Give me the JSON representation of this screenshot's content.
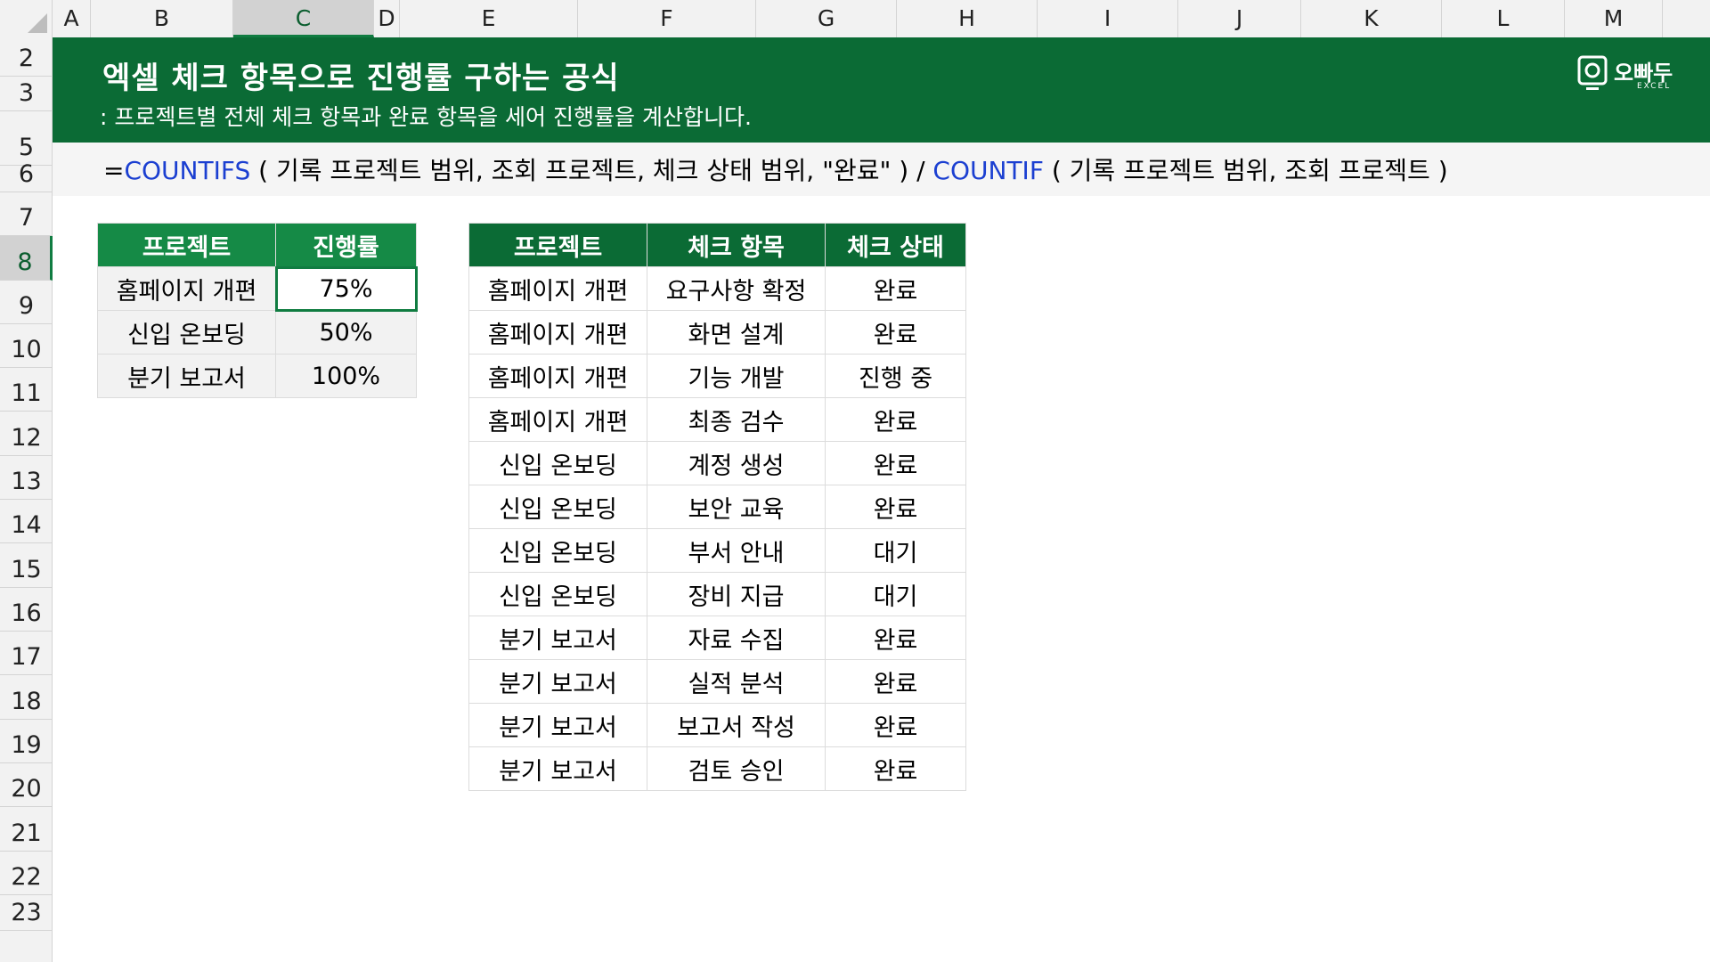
{
  "columns": [
    "A",
    "B",
    "C",
    "D",
    "E",
    "F",
    "G",
    "H",
    "I",
    "J",
    "K",
    "L",
    "M"
  ],
  "active_column": "C",
  "rows": [
    "2",
    "3",
    "5",
    "6",
    "7",
    "8",
    "9",
    "10",
    "11",
    "12",
    "13",
    "14",
    "15",
    "16",
    "17",
    "18",
    "19",
    "20",
    "21",
    "22",
    "23"
  ],
  "active_row": "8",
  "banner": {
    "title": "엑셀 체크 항목으로 진행률 구하는 공식",
    "subtitle": ": 프로젝트별 전체 체크 항목과 완료 항목을 세어 진행률을 계산합니다.",
    "logo_text": "오빠두",
    "logo_sub": "EXCEL"
  },
  "formula": {
    "eq": "=",
    "fn1": "COUNTIFS",
    "args1": " ( 기록 프로젝트 범위, 조회 프로젝트, 체크 상태 범위, \"완료\" ) / ",
    "fn2": "COUNTIF",
    "args2": " ( 기록 프로젝트 범위, 조회 프로젝트 )"
  },
  "summary_table": {
    "headers": [
      "프로젝트",
      "진행률"
    ],
    "rows": [
      [
        "홈페이지 개편",
        "75%"
      ],
      [
        "신입 온보딩",
        "50%"
      ],
      [
        "분기 보고서",
        "100%"
      ]
    ]
  },
  "detail_table": {
    "headers": [
      "프로젝트",
      "체크 항목",
      "체크 상태"
    ],
    "rows": [
      [
        "홈페이지 개편",
        "요구사항 확정",
        "완료"
      ],
      [
        "홈페이지 개편",
        "화면 설계",
        "완료"
      ],
      [
        "홈페이지 개편",
        "기능 개발",
        "진행 중"
      ],
      [
        "홈페이지 개편",
        "최종 검수",
        "완료"
      ],
      [
        "신입 온보딩",
        "계정 생성",
        "완료"
      ],
      [
        "신입 온보딩",
        "보안 교육",
        "완료"
      ],
      [
        "신입 온보딩",
        "부서 안내",
        "대기"
      ],
      [
        "신입 온보딩",
        "장비 지급",
        "대기"
      ],
      [
        "분기 보고서",
        "자료 수집",
        "완료"
      ],
      [
        "분기 보고서",
        "실적 분석",
        "완료"
      ],
      [
        "분기 보고서",
        "보고서 작성",
        "완료"
      ],
      [
        "분기 보고서",
        "검토 승인",
        "완료"
      ]
    ]
  },
  "colors": {
    "brand_green": "#0b6b35",
    "header_green": "#158a46",
    "function_blue": "#1b3fd1"
  }
}
